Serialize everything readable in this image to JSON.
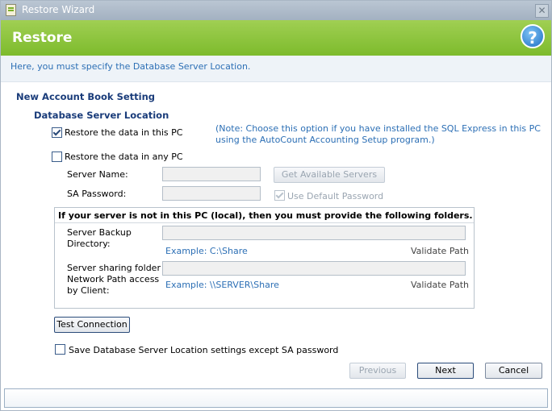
{
  "window": {
    "title": "Restore Wizard",
    "close_glyph": "✕"
  },
  "banner": {
    "title": "Restore",
    "help_glyph": "?"
  },
  "instruction": "Here, you must specify the Database Server Location.",
  "section_title": "New Account Book Setting",
  "subsection_title": "Database Server Location",
  "restore_local": {
    "label": "Restore the data in this PC",
    "checked": true,
    "note_line1": "(Note: Choose this option if you have installed the SQL Express in this PC",
    "note_line2": "using the AutoCount Accounting Setup program.)"
  },
  "restore_any": {
    "label": "Restore the data in any PC",
    "checked": false
  },
  "server_name": {
    "label": "Server Name:",
    "value": ""
  },
  "get_servers_button": "Get Available Servers",
  "sa_password": {
    "label": "SA Password:",
    "value": ""
  },
  "use_default_password": {
    "label": "Use Default Password",
    "checked": true
  },
  "folders_group": {
    "heading": "If your server is not in this PC (local), then you must provide the following folders.",
    "backup_dir": {
      "label_line1": "Server Backup",
      "label_line2": "Directory:",
      "value": "",
      "example": "Example: C:\\Share",
      "validate": "Validate Path"
    },
    "network_path": {
      "label_line1": "Server sharing folder",
      "label_line2": "Network Path access",
      "label_line3": "by Client:",
      "value": "",
      "example": "Example: \\\\SERVER\\Share",
      "validate": "Validate Path"
    }
  },
  "test_connection_button": "Test Connection",
  "save_settings": {
    "label": "Save Database Server Location settings except SA password",
    "checked": false
  },
  "footer": {
    "previous": "Previous",
    "next": "Next",
    "cancel": "Cancel"
  },
  "progress": {
    "fraction": 0.0
  }
}
